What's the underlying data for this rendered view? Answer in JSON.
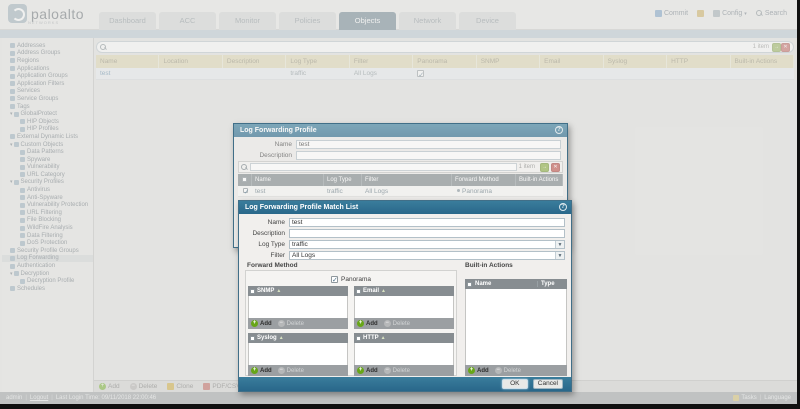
{
  "colors": {
    "dialog_header_teal": "#2e7492",
    "table_header_tan": "#ddd5ac",
    "active_tab": "#5f7886",
    "add_green": "#67a617",
    "link_blue": "#5b87a8"
  },
  "header": {
    "logo_text": "paloalto",
    "logo_sub": "NETWORKS",
    "tabs": [
      {
        "label": "Dashboard"
      },
      {
        "label": "ACC"
      },
      {
        "label": "Monitor"
      },
      {
        "label": "Policies"
      },
      {
        "label": "Objects",
        "cls": "active"
      },
      {
        "label": "Network"
      },
      {
        "label": "Device"
      }
    ],
    "commit_label": "Commit",
    "config_label": "Config",
    "search_label": "Search"
  },
  "sidebar": {
    "items": [
      {
        "label": "Addresses"
      },
      {
        "label": "Address Groups"
      },
      {
        "label": "Regions"
      },
      {
        "label": "Applications"
      },
      {
        "label": "Application Groups"
      },
      {
        "label": "Application Filters"
      },
      {
        "label": "Services"
      },
      {
        "label": "Service Groups"
      },
      {
        "label": "Tags"
      },
      {
        "label": "GlobalProtect",
        "cls": "exp"
      },
      {
        "label": "HIP Objects",
        "cls": "lvl1"
      },
      {
        "label": "HIP Profiles",
        "cls": "lvl1"
      },
      {
        "label": "External Dynamic Lists"
      },
      {
        "label": "Custom Objects",
        "cls": "exp"
      },
      {
        "label": "Data Patterns",
        "cls": "lvl1"
      },
      {
        "label": "Spyware",
        "cls": "lvl1"
      },
      {
        "label": "Vulnerability",
        "cls": "lvl1"
      },
      {
        "label": "URL Category",
        "cls": "lvl1"
      },
      {
        "label": "Security Profiles",
        "cls": "exp"
      },
      {
        "label": "Antivirus",
        "cls": "lvl1"
      },
      {
        "label": "Anti-Spyware",
        "cls": "lvl1"
      },
      {
        "label": "Vulnerability Protection",
        "cls": "lvl1"
      },
      {
        "label": "URL Filtering",
        "cls": "lvl1"
      },
      {
        "label": "File Blocking",
        "cls": "lvl1"
      },
      {
        "label": "WildFire Analysis",
        "cls": "lvl1"
      },
      {
        "label": "Data Filtering",
        "cls": "lvl1"
      },
      {
        "label": "DoS Protection",
        "cls": "lvl1"
      },
      {
        "label": "Security Profile Groups"
      },
      {
        "label": "Log Forwarding",
        "cls": "sel"
      },
      {
        "label": "Authentication"
      },
      {
        "label": "Decryption",
        "cls": "exp"
      },
      {
        "label": "Decryption Profile",
        "cls": "lvl1"
      },
      {
        "label": "Schedules"
      }
    ]
  },
  "content": {
    "search": {
      "value": "",
      "count": "1 item"
    },
    "table": {
      "columns": [
        "Name",
        "Location",
        "Description",
        "Log Type",
        "Filter",
        "Panorama",
        "SNMP",
        "Email",
        "Syslog",
        "HTTP",
        "Built-in Actions"
      ],
      "row": {
        "name": "test",
        "location": "",
        "description": "",
        "log_type": "traffic",
        "filter": "All Logs",
        "panorama_checked": true
      }
    },
    "footer_buttons": {
      "add": "Add",
      "delete": "Delete",
      "clone": "Clone",
      "pdf_csv": "PDF/CSV"
    }
  },
  "statusbar": {
    "user": "admin",
    "logout": "Logout",
    "last_login": "Last Login Time: 09/11/2018 22:00:46",
    "tasks": "Tasks",
    "language": "Language"
  },
  "dialog1": {
    "title": "Log Forwarding Profile",
    "name_label": "Name",
    "name_value": "test",
    "desc_label": "Description",
    "desc_value": "",
    "search_count": "1 item",
    "table": {
      "columns": [
        "Name",
        "Log Type",
        "Filter",
        "Forward Method",
        "Built-in Actions"
      ],
      "row": {
        "name": "test",
        "log_type": "traffic",
        "filter": "All Logs",
        "forward_method": "Panorama"
      }
    }
  },
  "dialog2": {
    "title": "Log Forwarding Profile Match List",
    "name_label": "Name",
    "name_value": "test",
    "desc_label": "Description",
    "desc_value": "",
    "log_type_label": "Log Type",
    "log_type_value": "traffic",
    "filter_label": "Filter",
    "filter_value": "All Logs",
    "forward_method": {
      "group_label": "Forward Method",
      "panorama_label": "Panorama",
      "panorama_checked": true,
      "tables": [
        {
          "title": "SNMP"
        },
        {
          "title": "Email"
        },
        {
          "title": "Syslog"
        },
        {
          "title": "HTTP"
        }
      ],
      "add_label": "Add",
      "delete_label": "Delete"
    },
    "builtin": {
      "group_label": "Built-in Actions",
      "columns": [
        "Name",
        "Type"
      ],
      "add_label": "Add",
      "delete_label": "Delete"
    },
    "ok_label": "OK",
    "cancel_label": "Cancel"
  }
}
